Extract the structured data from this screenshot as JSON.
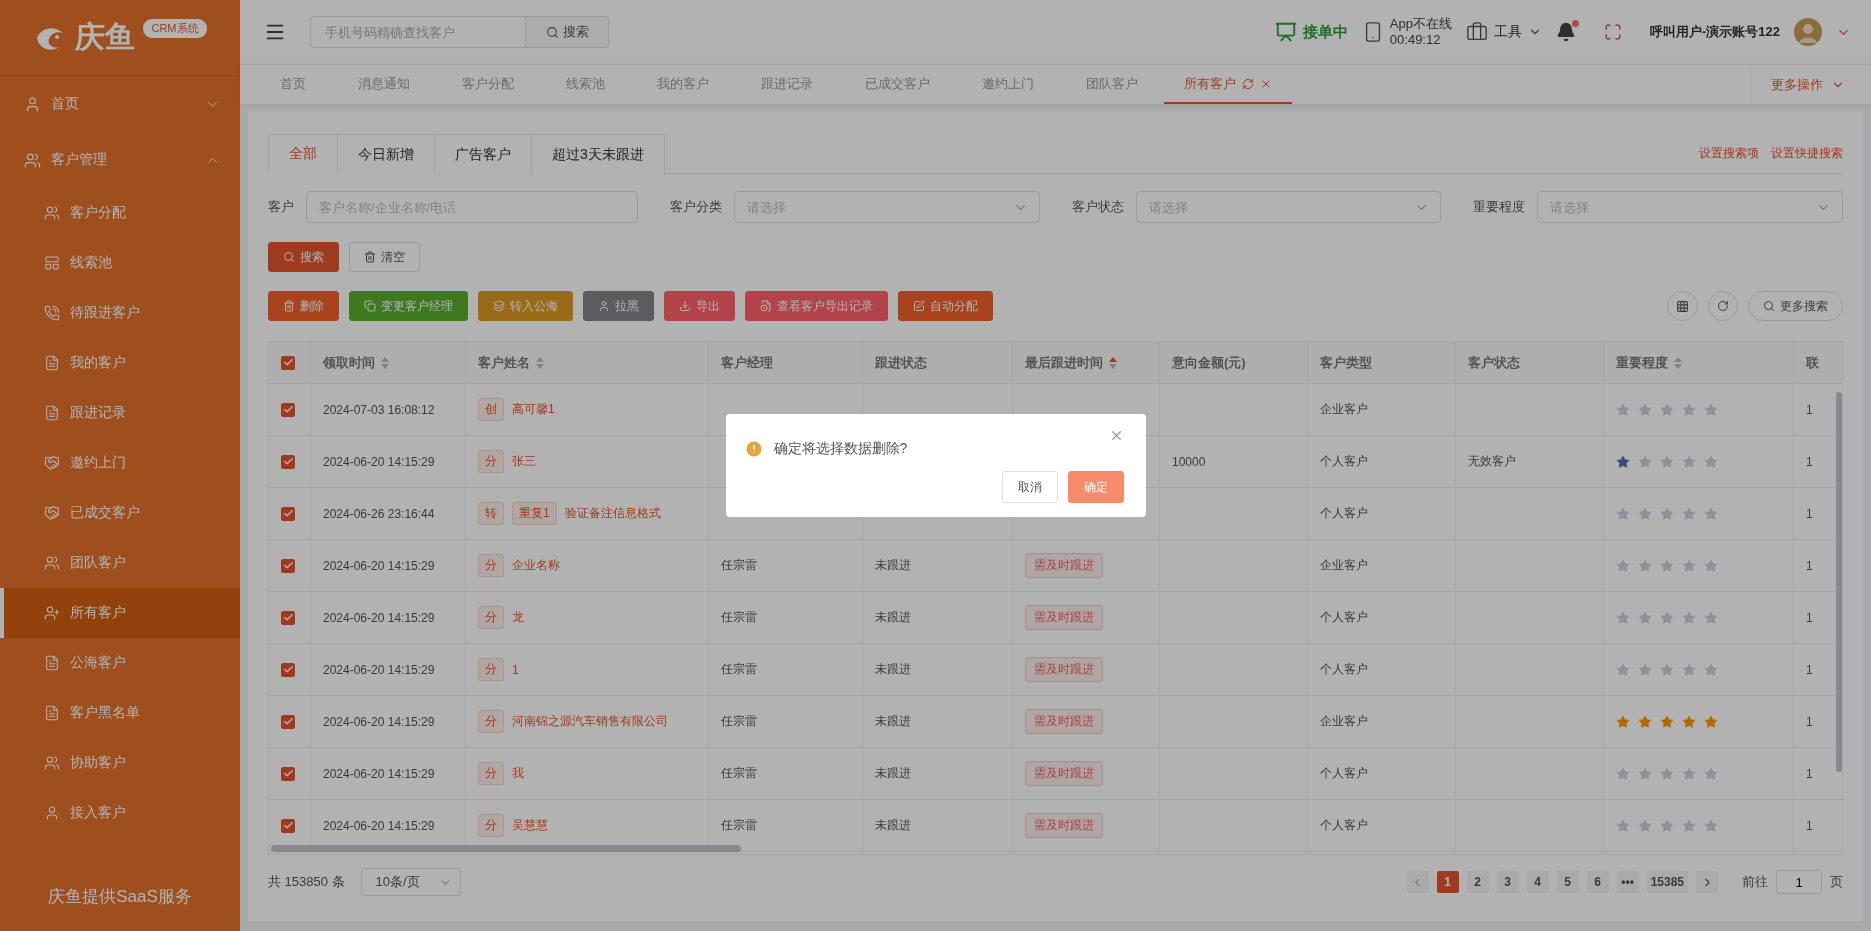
{
  "sidebar": {
    "logo": {
      "name": "庆鱼",
      "badge": "CRM系统"
    },
    "items": [
      {
        "label": "首页",
        "expanded": false,
        "selected": false
      },
      {
        "label": "客户管理",
        "expanded": true,
        "selected": false,
        "children": [
          {
            "label": "客户分配",
            "selected": false
          },
          {
            "label": "线索池",
            "selected": false
          },
          {
            "label": "待跟进客户",
            "selected": false
          },
          {
            "label": "我的客户",
            "selected": false
          },
          {
            "label": "跟进记录",
            "selected": false
          },
          {
            "label": "邀约上门",
            "selected": false
          },
          {
            "label": "已成交客户",
            "selected": false
          },
          {
            "label": "团队客户",
            "selected": false
          },
          {
            "label": "所有客户",
            "selected": true
          },
          {
            "label": "公海客户",
            "selected": false
          },
          {
            "label": "客户黑名单",
            "selected": false
          },
          {
            "label": "协助客户",
            "selected": false
          },
          {
            "label": "接入客户",
            "selected": false
          }
        ]
      }
    ],
    "footer": "庆鱼提供SaaS服务"
  },
  "topbar": {
    "search": {
      "placeholder": "手机号码精确查找客户",
      "button": "搜索"
    },
    "order_status": "接单中",
    "app_status": "App不在线",
    "app_time": "00:49:12",
    "tools": "工具",
    "notification": {
      "unread": true
    },
    "user": "呼叫用户-演示账号122"
  },
  "tabs": [
    {
      "label": "首页",
      "selected": false
    },
    {
      "label": "消息通知",
      "selected": false
    },
    {
      "label": "客户分配",
      "selected": false
    },
    {
      "label": "线索池",
      "selected": false
    },
    {
      "label": "我的客户",
      "selected": false
    },
    {
      "label": "跟进记录",
      "selected": false
    },
    {
      "label": "已成交客户",
      "selected": false
    },
    {
      "label": "邀约上门",
      "selected": false
    },
    {
      "label": "团队客户",
      "selected": false
    },
    {
      "label": "所有客户",
      "selected": true
    }
  ],
  "more_actions": "更多操作",
  "filter_tabs": [
    {
      "label": "全部",
      "selected": true
    },
    {
      "label": "今日新增",
      "selected": false
    },
    {
      "label": "广告客户",
      "selected": false
    },
    {
      "label": "超过3天未跟进",
      "selected": false
    }
  ],
  "filter_links": [
    "设置搜索项",
    "设置快捷搜索"
  ],
  "filters": [
    {
      "kind": "input",
      "label": "客户",
      "placeholder": "客户名称/企业名称/电话"
    },
    {
      "kind": "select",
      "label": "客户分类",
      "placeholder": "请选择"
    },
    {
      "kind": "select",
      "label": "客户状态",
      "placeholder": "请选择"
    },
    {
      "kind": "select",
      "label": "重要程度",
      "placeholder": "请选择"
    }
  ],
  "search_buttons": [
    "搜索",
    "清空"
  ],
  "actions": [
    {
      "label": "删除",
      "color": "#a9441e"
    },
    {
      "label": "变更客户经理",
      "color": "#3f7a20"
    },
    {
      "label": "转入公海",
      "color": "#9a6c1a"
    },
    {
      "label": "拉黑",
      "color": "#5c5d60"
    },
    {
      "label": "导出",
      "color": "#b34448"
    },
    {
      "label": "查看客户导出记录",
      "color": "#b34448"
    },
    {
      "label": "自动分配",
      "color": "#a9441e"
    }
  ],
  "more_search": "更多搜索",
  "table": {
    "all_checked": true,
    "columns": [
      {
        "label": "领取时间",
        "sortable": true,
        "sort_active": false
      },
      {
        "label": "客户姓名",
        "sortable": true,
        "sort_active": false
      },
      {
        "label": "客户经理",
        "sortable": false
      },
      {
        "label": "跟进状态",
        "sortable": false
      },
      {
        "label": "最后跟进时间",
        "sortable": true,
        "sort_active": true
      },
      {
        "label": "意向金额(元)",
        "sortable": false
      },
      {
        "label": "客户类型",
        "sortable": false
      },
      {
        "label": "客户状态",
        "sortable": false
      },
      {
        "label": "重要程度",
        "sortable": true,
        "sort_active": false
      },
      {
        "label": "联",
        "sortable": false
      }
    ],
    "rows": [
      {
        "checked": true,
        "time": "2024-07-03 16:08:12",
        "tags": [
          "创"
        ],
        "name": "高可馨1",
        "type": "企业客户",
        "stars": 0,
        "column_11": "1"
      },
      {
        "checked": true,
        "time": "2024-06-20 14:15:29",
        "tags": [
          "分"
        ],
        "name": "张三",
        "amount": "10000",
        "type": "个人客户",
        "status": "无效客户",
        "stars": 1,
        "column_11": "1"
      },
      {
        "checked": true,
        "time": "2024-06-26 23:16:44",
        "tags": [
          "转",
          "重复1"
        ],
        "name": "验证备注信息格式",
        "type": "个人客户",
        "stars": 0,
        "column_11": "1"
      },
      {
        "checked": true,
        "time": "2024-06-20 14:15:29",
        "tags": [
          "分"
        ],
        "name": "企业名称",
        "manager": "任宗雷",
        "follow_status": "未跟进",
        "last_follow": "需及时跟进",
        "type": "企业客户",
        "stars": 0,
        "column_11": "1"
      },
      {
        "checked": true,
        "time": "2024-06-20 14:15:29",
        "tags": [
          "分"
        ],
        "name": "龙",
        "manager": "任宗雷",
        "follow_status": "未跟进",
        "last_follow": "需及时跟进",
        "type": "个人客户",
        "stars": 0,
        "column_11": "1"
      },
      {
        "checked": true,
        "time": "2024-06-20 14:15:29",
        "tags": [
          "分"
        ],
        "name": "1",
        "manager": "任宗雷",
        "follow_status": "未跟进",
        "last_follow": "需及时跟进",
        "type": "个人客户",
        "stars": 0,
        "column_11": "1"
      },
      {
        "checked": true,
        "time": "2024-06-20 14:15:29",
        "tags": [
          "分"
        ],
        "name": "河南锦之源汽车销售有限公司",
        "manager": "任宗雷",
        "follow_status": "未跟进",
        "last_follow": "需及时跟进",
        "type": "企业客户",
        "stars": 5,
        "column_11": "1"
      },
      {
        "checked": true,
        "time": "2024-06-20 14:15:29",
        "tags": [
          "分"
        ],
        "name": "我",
        "manager": "任宗雷",
        "follow_status": "未跟进",
        "last_follow": "需及时跟进",
        "type": "个人客户",
        "stars": 0,
        "column_11": "1"
      },
      {
        "checked": true,
        "time": "2024-06-20 14:15:29",
        "tags": [
          "分"
        ],
        "name": "吴慧慧",
        "manager": "任宗雷",
        "follow_status": "未跟进",
        "last_follow": "需及时跟进",
        "type": "个人客户",
        "stars": 0,
        "column_11": "1"
      }
    ]
  },
  "pagination": {
    "total": "共 153850 条",
    "page_size": "10条/页",
    "pages": [
      {
        "label": "1",
        "selected": true
      },
      {
        "label": "2",
        "selected": false
      },
      {
        "label": "3",
        "selected": false
      },
      {
        "label": "4",
        "selected": false
      },
      {
        "label": "5",
        "selected": false
      },
      {
        "label": "6",
        "selected": false
      },
      {
        "label": "•••",
        "selected": false
      },
      {
        "label": "15385",
        "selected": false
      }
    ],
    "goto_label": "前往",
    "goto_value": "1",
    "goto_unit": "页"
  },
  "dialog": {
    "message": "确定将选择数据删除?",
    "cancel": "取消",
    "confirm": "确定"
  }
}
